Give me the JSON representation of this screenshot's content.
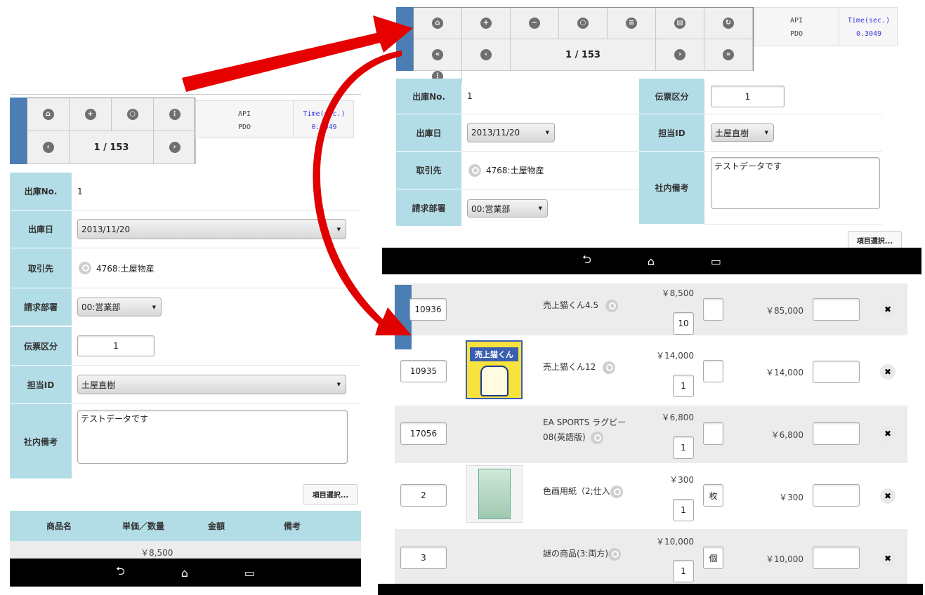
{
  "left": {
    "toolbar": {
      "page": "1 / 153"
    },
    "api": {
      "label1": "API",
      "label2": "PDO",
      "time_label": "Time(sec.)",
      "time_value": "0.3049"
    },
    "form": {
      "shipping_no_label": "出庫No.",
      "shipping_no": "1",
      "ship_date_label": "出庫日",
      "ship_date": "2013/11/20",
      "customer_label": "取引先",
      "customer": "4768:土屋物産",
      "dept_label": "請求部署",
      "dept": "00:営業部",
      "slip_type_label": "伝票区分",
      "slip_type": "1",
      "staff_label": "担当ID",
      "staff": "土屋直樹",
      "memo_label": "社内備考",
      "memo": "テストデータです"
    },
    "select_items_button": "項目選択...",
    "table_header": {
      "name": "商品名",
      "price_qty": "単価／数量",
      "amount": "金額",
      "note": "備考"
    },
    "first_row_price": "￥8,500"
  },
  "right_top": {
    "toolbar": {
      "page": "1 / 153"
    },
    "api": {
      "label1": "API",
      "label2": "PDO",
      "time_label": "Time(sec.)",
      "time_value": "0.3049"
    },
    "form": {
      "shipping_no_label": "出庫No.",
      "shipping_no": "1",
      "ship_date_label": "出庫日",
      "ship_date": "2013/11/20",
      "customer_label": "取引先",
      "customer": "4768:土屋物産",
      "dept_label": "請求部署",
      "dept": "00:営業部",
      "slip_type_label": "伝票区分",
      "slip_type": "1",
      "staff_label": "担当ID",
      "staff": "土屋直樹",
      "memo_label": "社内備考",
      "memo": "テストデータです"
    },
    "select_items_button": "項目選択..."
  },
  "right_bottom": {
    "rows": [
      {
        "code": "10936",
        "name": "売上猫くん4.5",
        "unit_price": "￥8,500",
        "qty": "10",
        "unit": "",
        "amount": "￥85,000",
        "has_image": false
      },
      {
        "code": "10935",
        "name": "売上猫くん12",
        "unit_price": "￥14,000",
        "qty": "1",
        "unit": "",
        "amount": "￥14,000",
        "has_image": true
      },
      {
        "code": "17056",
        "name": "EA SPORTS ラグビー08(英語版)",
        "unit_price": "￥6,800",
        "qty": "1",
        "unit": "",
        "amount": "￥6,800",
        "has_image": false
      },
      {
        "code": "2",
        "name": "色画用紙（2;仕入",
        "unit_price": "￥300",
        "qty": "1",
        "unit": "枚",
        "amount": "￥300",
        "has_image": true
      },
      {
        "code": "3",
        "name": "謎の商品(3:両方)",
        "unit_price": "￥10,000",
        "qty": "1",
        "unit": "個",
        "amount": "￥10,000",
        "has_image": false
      }
    ],
    "product_box_text": "売上猫くん"
  },
  "colors": {
    "label_bg": "#b3dde6",
    "tab_blue": "#4a7eb5",
    "arrow_red": "#e60000",
    "navbar": "#000000"
  }
}
